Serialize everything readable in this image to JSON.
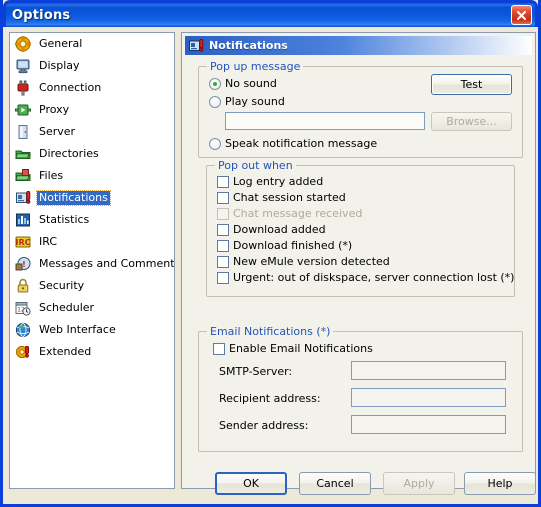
{
  "window": {
    "title": "Options",
    "close_label": "Close",
    "frame_color": "#0a3fd8",
    "background_color": "#ece9d8"
  },
  "sidebar": {
    "selected_index": 7,
    "items": [
      {
        "label": "General",
        "icon": "gear-icon"
      },
      {
        "label": "Display",
        "icon": "monitor-icon"
      },
      {
        "label": "Connection",
        "icon": "plug-icon"
      },
      {
        "label": "Proxy",
        "icon": "proxy-icon"
      },
      {
        "label": "Server",
        "icon": "server-icon"
      },
      {
        "label": "Directories",
        "icon": "folder-green-icon"
      },
      {
        "label": "Files",
        "icon": "files-icon"
      },
      {
        "label": "Notifications",
        "icon": "notifications-icon"
      },
      {
        "label": "Statistics",
        "icon": "statistics-icon"
      },
      {
        "label": "IRC",
        "icon": "irc-icon"
      },
      {
        "label": "Messages and Comments",
        "icon": "messages-icon"
      },
      {
        "label": "Security",
        "icon": "lock-icon"
      },
      {
        "label": "Scheduler",
        "icon": "calendar-clock-icon"
      },
      {
        "label": "Web Interface",
        "icon": "globe-icon"
      },
      {
        "label": "Extended",
        "icon": "extended-icon"
      }
    ]
  },
  "pane": {
    "header_title": "Notifications",
    "header_icon": "notifications-icon",
    "popup_group": {
      "title": "Pop up message",
      "selected_option": "No sound",
      "options": [
        {
          "label": "No sound",
          "selected": true
        },
        {
          "label": "Play sound",
          "selected": false
        },
        {
          "label": "Speak notification message",
          "selected": false
        }
      ],
      "sound_path_value": "",
      "sound_path_placeholder": "",
      "test_button": "Test",
      "browse_button": "Browse...",
      "browse_enabled": false
    },
    "popout_group": {
      "title": "Pop out when",
      "checkboxes": [
        {
          "label": "Log entry added",
          "checked": false,
          "enabled": true
        },
        {
          "label": "Chat session started",
          "checked": false,
          "enabled": true
        },
        {
          "label": "Chat message received",
          "checked": false,
          "enabled": false
        },
        {
          "label": "Download added",
          "checked": false,
          "enabled": true
        },
        {
          "label": "Download finished (*)",
          "checked": false,
          "enabled": true
        },
        {
          "label": "New eMule version detected",
          "checked": false,
          "enabled": true
        },
        {
          "label": "Urgent: out of diskspace, server connection lost (*)",
          "checked": false,
          "enabled": true
        }
      ]
    },
    "email_group": {
      "title": "Email Notifications (*)",
      "enable_checkbox": {
        "label": "Enable Email Notifications",
        "checked": false
      },
      "fields": [
        {
          "label": "SMTP-Server:",
          "value": ""
        },
        {
          "label": "Recipient address:",
          "value": ""
        },
        {
          "label": "Sender address:",
          "value": ""
        }
      ]
    }
  },
  "footer": {
    "ok": "OK",
    "cancel": "Cancel",
    "apply": "Apply",
    "apply_enabled": false,
    "help": "Help"
  }
}
